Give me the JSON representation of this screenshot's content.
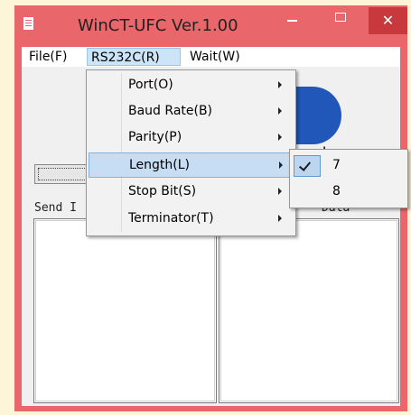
{
  "window": {
    "title": "WinCT-UFC  Ver.1.00",
    "close_glyph": "✕",
    "accent": "#e9676b"
  },
  "menubar": {
    "items": [
      {
        "label": "File(F)"
      },
      {
        "label": "RS232C(R)",
        "active": true
      },
      {
        "label": "Wait(W)"
      }
    ]
  },
  "background": {
    "logo_fragment": "red",
    "label_send": "Send I",
    "label_data": "Data"
  },
  "rs232c_menu": {
    "items": [
      {
        "label": "Port(O)"
      },
      {
        "label": "Baud Rate(B)"
      },
      {
        "label": "Parity(P)"
      },
      {
        "label": "Length(L)",
        "highlighted": true
      },
      {
        "label": "Stop Bit(S)"
      },
      {
        "label": "Terminator(T)"
      }
    ]
  },
  "length_submenu": {
    "items": [
      {
        "label": "7",
        "checked": true
      },
      {
        "label": "8",
        "checked": false
      }
    ]
  }
}
